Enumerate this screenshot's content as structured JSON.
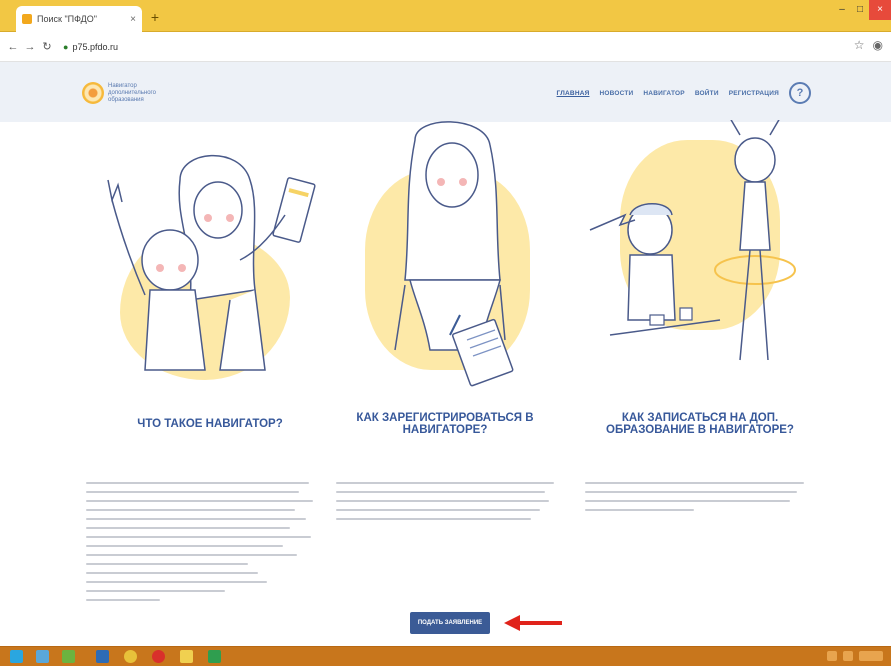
{
  "browser": {
    "tab_title": "Поиск \"ПФДО\"",
    "tab_close": "×",
    "new_tab": "+",
    "url": "р75.pfdo.ru",
    "window_controls": [
      "–",
      "□",
      "×"
    ]
  },
  "site": {
    "logo_text": "Навигатор дополнительного образования",
    "nav": [
      "ГЛАВНАЯ",
      "НОВОСТИ",
      "НАВИГАТОР",
      "ВОЙТИ",
      "РЕГИСТРАЦИЯ"
    ],
    "help_label": "?"
  },
  "columns": [
    {
      "title": "ЧТО ТАКОЕ НАВИГАТОР?"
    },
    {
      "title": "КАК ЗАРЕГИСТРИРОВАТЬСЯ В НАВИГАТОРЕ?"
    },
    {
      "title": "КАК ЗАПИСАТЬСЯ НА ДОП. ОБРАЗОВАНИЕ В НАВИГАТОРЕ?"
    }
  ],
  "submit_button": "ПОДАТЬ ЗАЯВЛЕНИЕ",
  "colors": {
    "accent": "#37589a",
    "tabbar": "#f2c744",
    "blob": "#fde9a8",
    "arrow": "#e0231b",
    "taskbar": "#c8761c"
  }
}
